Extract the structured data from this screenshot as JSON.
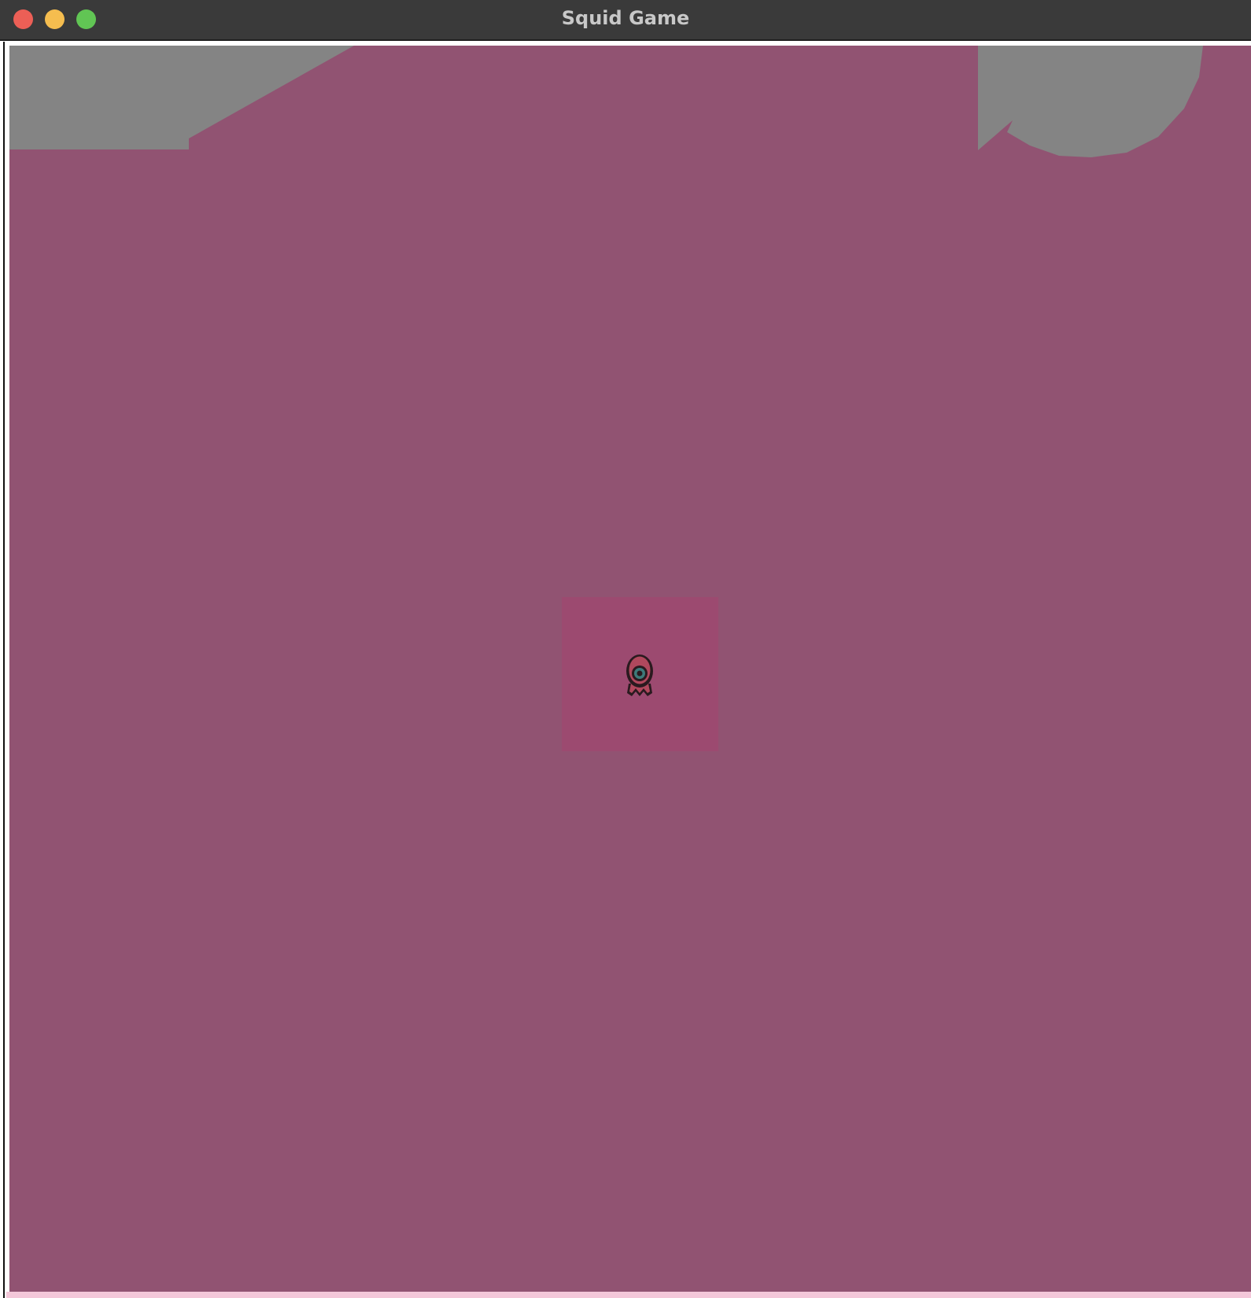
{
  "window": {
    "title": "Squid Game",
    "controls": {
      "close_color": "#ec5f56",
      "minimize_color": "#f5bd4f",
      "maximize_color": "#61c554"
    }
  },
  "game": {
    "background_color": "#915372",
    "obstacle_color": "#848484",
    "highlight_color": "#9c4a70",
    "player": {
      "icon": "squid-guard-circle-icon",
      "colors": {
        "body": "#b0485d",
        "outline": "#2a1a1f",
        "mark": "#3d7a7a"
      }
    }
  }
}
